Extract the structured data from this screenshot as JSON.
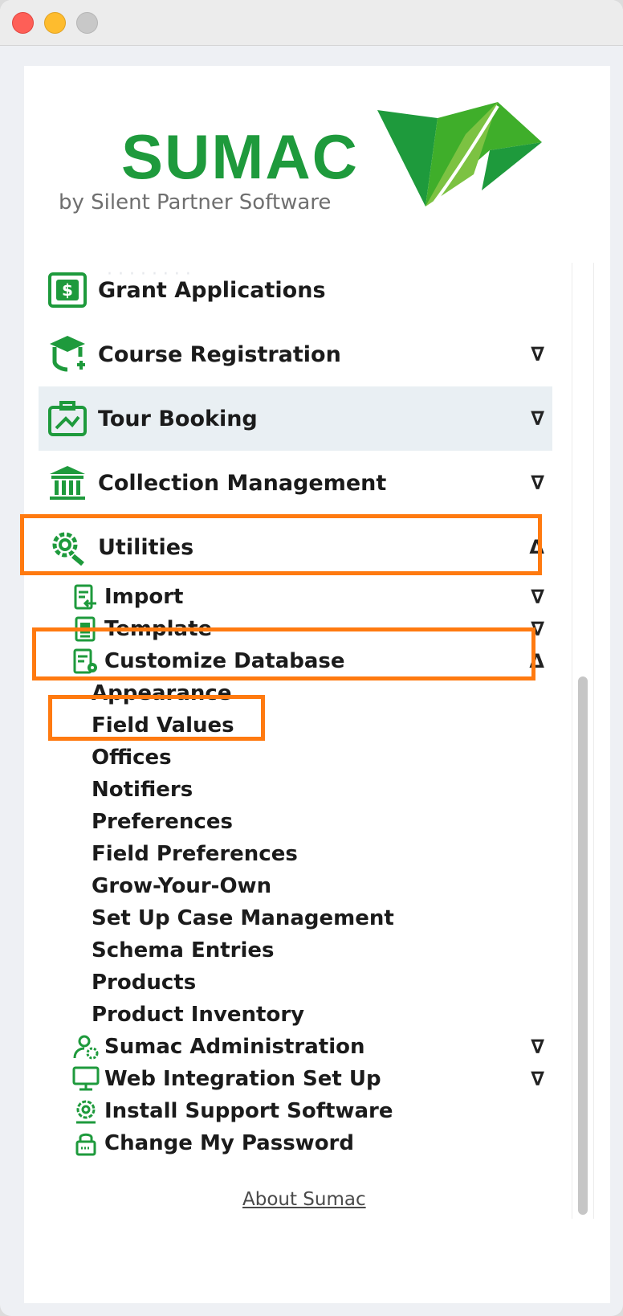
{
  "brand": {
    "name": "SUMAC",
    "tagline": "by Silent Partner Software",
    "brand_color": "#1e9a3c"
  },
  "menu": {
    "top_items": [
      {
        "label": "Grant Applications",
        "icon": "grant-icon",
        "expander": ""
      },
      {
        "label": "Course Registration",
        "icon": "course-icon",
        "expander": "∇"
      },
      {
        "label": "Tour Booking",
        "icon": "tour-icon",
        "expander": "∇",
        "highlighted": true
      },
      {
        "label": "Collection Management",
        "icon": "museum-icon",
        "expander": "∇"
      },
      {
        "label": "Utilities",
        "icon": "gear-wrench-icon",
        "expander": "Δ"
      }
    ],
    "utilities_children": [
      {
        "label": "Import",
        "icon": "import-icon",
        "expander": "∇"
      },
      {
        "label": "Template",
        "icon": "template-icon",
        "expander": "∇"
      },
      {
        "label": "Customize Database",
        "icon": "database-gear-icon",
        "expander": "Δ"
      }
    ],
    "customize_children": [
      "Appearance",
      "Field Values",
      "Offices",
      "Notifiers",
      "Preferences",
      "Field Preferences",
      "Grow-Your-Own",
      "Set Up Case Management",
      "Schema Entries",
      "Products",
      "Product Inventory"
    ],
    "more_utilities": [
      {
        "label": "Sumac Administration",
        "icon": "admin-user-icon",
        "expander": "∇"
      },
      {
        "label": "Web Integration Set Up",
        "icon": "monitor-icon",
        "expander": "∇"
      },
      {
        "label": "Install Support Software",
        "icon": "support-gear-icon",
        "expander": ""
      },
      {
        "label": "Change My Password",
        "icon": "lock-icon",
        "expander": ""
      }
    ]
  },
  "footer": {
    "about_link": "About Sumac"
  },
  "colors": {
    "highlight_box": "#ff7a10",
    "icon_green": "#1e9a3c"
  }
}
